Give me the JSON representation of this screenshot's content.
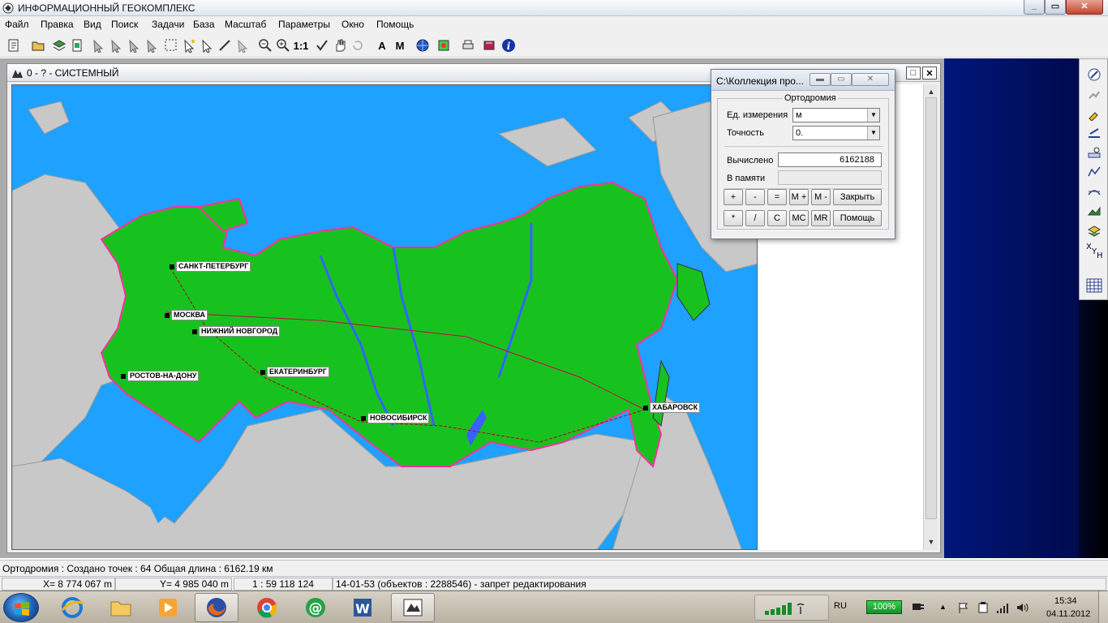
{
  "app": {
    "title": "ИНФОРМАЦИОННЫЙ ГЕОКОМПЛЕКС"
  },
  "menu": [
    "Файл",
    "Правка",
    "Вид",
    "Поиск",
    "Задачи",
    "База",
    "Масштаб",
    "Параметры",
    "Окно",
    "Помощь"
  ],
  "toolbar": {
    "scale_button": "1:1",
    "text_button": "A",
    "measure_button": "M"
  },
  "child_window": {
    "title": "0 -  ?  - СИСТЕМНЫЙ"
  },
  "map": {
    "cities": [
      {
        "name": "САНКТ-ПЕТЕРБУРГ"
      },
      {
        "name": "МОСКВА"
      },
      {
        "name": "НИЖНИЙ НОВГОРОД"
      },
      {
        "name": "РОСТОВ-НА-ДОНУ"
      },
      {
        "name": "ЕКАТЕРИНБУРГ"
      },
      {
        "name": "НОВОСИБИРСК"
      },
      {
        "name": "ХАБАРОВСК"
      }
    ],
    "colors": {
      "sea": "#1ea1ff",
      "land": "#c8c8c8",
      "territory": "#18c21e",
      "border": "#ff2fa0"
    }
  },
  "calculator": {
    "title": "C:\\Коллекция про...",
    "group_title": "Ортодромия",
    "units_label": "Ед. измерения",
    "units_value": "м",
    "precision_label": "Точность",
    "precision_value": "0.",
    "computed_label": "Вычислено",
    "computed_value": "6162188",
    "memory_label": "В памяти",
    "memory_value": "",
    "buttons": {
      "plus": "+",
      "minus": "-",
      "equals": "=",
      "m_plus": "M +",
      "m_minus": "M -",
      "close": "Закрыть",
      "multiply": "*",
      "divide": "/",
      "clear": "C",
      "mc": "MC",
      "mr": "MR",
      "help": "Помощь"
    }
  },
  "status": {
    "line1": "Ортодромия : Создано точек :  64   Общая длина :  6162.19  км",
    "x": "X=   8 774 067 m",
    "y": "Y=   4 985 040 m",
    "scale": "1 : 59 118 124",
    "info": "14-01-53   (объектов : 2288546) - запрет редактирования"
  },
  "taskbar": {
    "language": "RU",
    "battery": "100%",
    "time": "15:34",
    "date": "04.11.2012"
  }
}
